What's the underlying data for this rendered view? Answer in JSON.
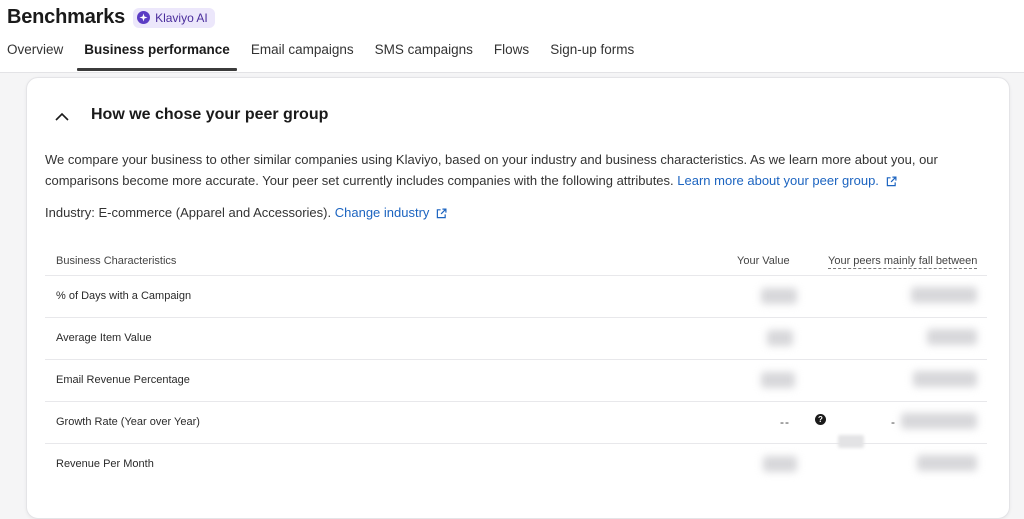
{
  "header": {
    "title": "Benchmarks",
    "ai_badge": "Klaviyo AI",
    "tabs": [
      {
        "label": "Overview",
        "active": false
      },
      {
        "label": "Business performance",
        "active": true
      },
      {
        "label": "Email campaigns",
        "active": false
      },
      {
        "label": "SMS campaigns",
        "active": false
      },
      {
        "label": "Flows",
        "active": false
      },
      {
        "label": "Sign-up forms",
        "active": false
      }
    ]
  },
  "section": {
    "title": "How we chose your peer group",
    "description": "We compare your business to other similar companies using Klaviyo, based on your industry and business characteristics. As we learn more about you, our comparisons become more accurate. Your peer set currently includes companies with the following attributes.",
    "learn_more_link": "Learn more about your peer group.",
    "industry_text": "Industry: E-commerce (Apparel and Accessories).",
    "change_industry_link": "Change industry"
  },
  "table": {
    "headers": {
      "characteristic": "Business Characteristics",
      "your_value": "Your Value",
      "peers": "Your peers mainly fall between"
    },
    "rows": [
      {
        "label": "% of Days with a Campaign",
        "your_value": "",
        "peers": ""
      },
      {
        "label": "Average Item Value",
        "your_value": "",
        "peers": ""
      },
      {
        "label": "Email Revenue Percentage",
        "your_value": "",
        "peers": ""
      },
      {
        "label": "Growth Rate (Year over Year)",
        "your_value": "--",
        "peers": ""
      },
      {
        "label": "Revenue Per Month",
        "your_value": "",
        "peers": ""
      }
    ],
    "help_icon_glyph": "?",
    "peer_prefix_mark": "-"
  },
  "colors": {
    "accent_link": "#1c64c0",
    "ai_badge_bg": "#ece7fb",
    "ai_badge_fg": "#5b3cc4"
  }
}
